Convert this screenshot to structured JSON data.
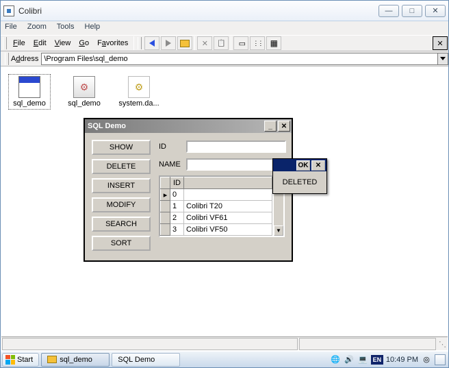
{
  "window": {
    "title": "Colibri"
  },
  "outer_menu": {
    "file": "File",
    "zoom": "Zoom",
    "tools": "Tools",
    "help": "Help"
  },
  "inner_menu": {
    "file": "File",
    "edit": "Edit",
    "view": "View",
    "go": "Go",
    "favorites": "Favorites"
  },
  "address": {
    "label": "Address",
    "path": "\\Program Files\\sql_demo"
  },
  "files": {
    "0": {
      "name": "sql_demo"
    },
    "1": {
      "name": "sql_demo"
    },
    "2": {
      "name": "system.da..."
    }
  },
  "sqlwin": {
    "title": "SQL Demo",
    "buttons": {
      "show": "SHOW",
      "delete": "DELETE",
      "insert": "INSERT",
      "modify": "MODIFY",
      "search": "SEARCH",
      "sort": "SORT"
    },
    "labels": {
      "id": "ID",
      "name": "NAME"
    },
    "grid": {
      "head_id": "ID",
      "rows": {
        "0": {
          "id": "0",
          "name": ""
        },
        "1": {
          "id": "1",
          "name": "Colibri T20"
        },
        "2": {
          "id": "2",
          "name": "Colibri VF61"
        },
        "3": {
          "id": "3",
          "name": "Colibri VF50"
        }
      }
    }
  },
  "popup": {
    "ok": "OK",
    "msg": "DELETED"
  },
  "taskbar": {
    "start": "Start",
    "task1": "sql_demo",
    "task2": "SQL Demo",
    "lang": "EN",
    "clock": "10:49 PM"
  }
}
